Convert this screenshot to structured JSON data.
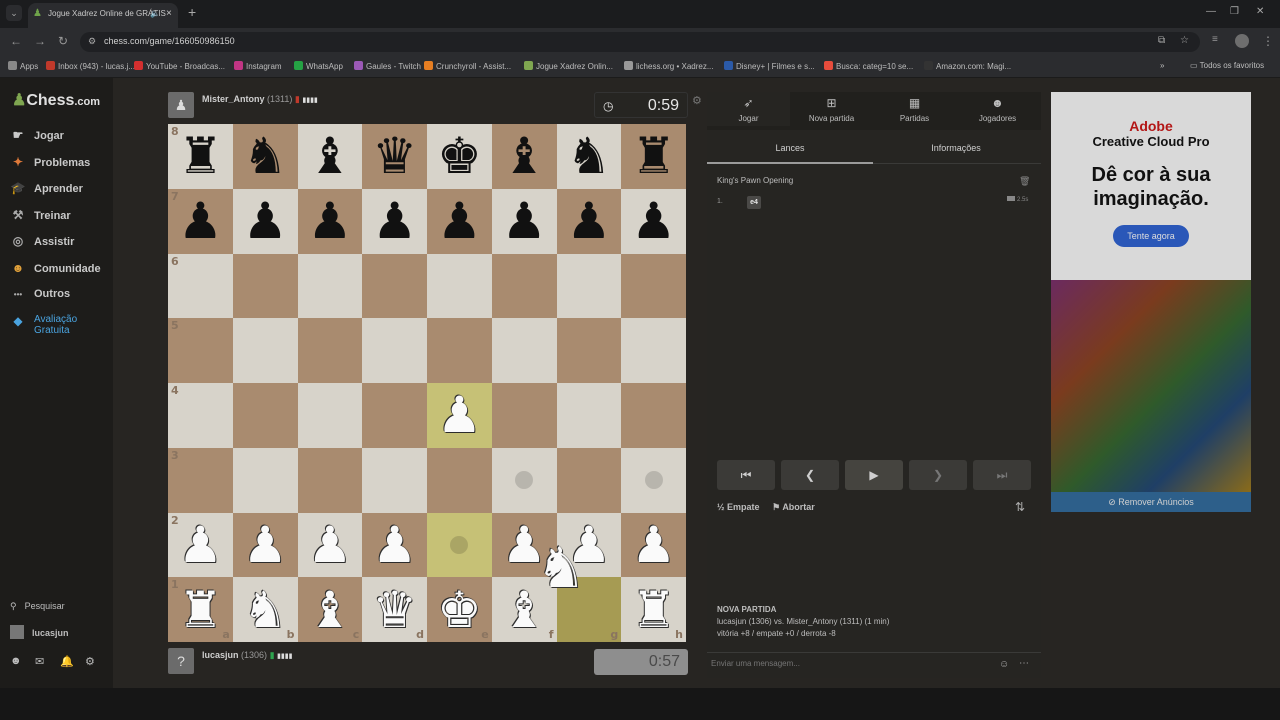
{
  "browser": {
    "tab_title": "Jogue Xadrez Online de GRÁTIS",
    "url": "chess.com/game/166050986150",
    "bookmarks": [
      {
        "label": "Apps",
        "color": "#888888"
      },
      {
        "label": "Inbox (943) - lucas.j...",
        "color": "#c0392b"
      },
      {
        "label": "YouTube - Broadcas...",
        "color": "#d32f2f"
      },
      {
        "label": "Instagram",
        "color": "#c13584"
      },
      {
        "label": "WhatsApp",
        "color": "#25a244"
      },
      {
        "label": "Gaules - Twitch",
        "color": "#9b59b6"
      },
      {
        "label": "Crunchyroll - Assist...",
        "color": "#e67e22"
      },
      {
        "label": "Jogue Xadrez Onlin...",
        "color": "#7fa650"
      },
      {
        "label": "lichess.org • Xadrez...",
        "color": "#999999"
      },
      {
        "label": "Disney+ | Filmes e s...",
        "color": "#2b5aa8"
      },
      {
        "label": "Busca: categ=10 se...",
        "color": "#e74c3c"
      },
      {
        "label": "Amazon.com: Magi...",
        "color": "#333333"
      }
    ],
    "favorites_label": "Todos os favoritos"
  },
  "sidebar": {
    "logo_a": "Chess",
    "logo_b": ".com",
    "items": [
      {
        "label": "Jogar",
        "icon": "play-hand-icon"
      },
      {
        "label": "Problemas",
        "icon": "puzzle-icon"
      },
      {
        "label": "Aprender",
        "icon": "graduation-cap-icon"
      },
      {
        "label": "Treinar",
        "icon": "train-icon"
      },
      {
        "label": "Assistir",
        "icon": "binoculars-icon"
      },
      {
        "label": "Comunidade",
        "icon": "community-icon"
      },
      {
        "label": "Outros",
        "icon": "more-icon"
      },
      {
        "label": "Avaliação Gratuita",
        "icon": "diamond-icon"
      }
    ],
    "search_label": "Pesquisar",
    "user_label": "lucasjun"
  },
  "top_player": {
    "name": "Mister_Antony",
    "rating": "(1311)",
    "clock": "0:59"
  },
  "bottom_player": {
    "name": "lucasjun",
    "rating": "(1306)",
    "clock": "0:57"
  },
  "board": {
    "rows": [
      [
        "br",
        "bn",
        "bb",
        "bq",
        "bk",
        "bb",
        "bn",
        "br"
      ],
      [
        "bp",
        "bp",
        "bp",
        "bp",
        "bp",
        "bp",
        "bp",
        "bp"
      ],
      [
        "",
        "",
        "",
        "",
        "",
        "",
        "",
        ""
      ],
      [
        "",
        "",
        "",
        "",
        "",
        "",
        "",
        ""
      ],
      [
        "",
        "",
        "",
        "",
        "wp",
        "",
        "",
        ""
      ],
      [
        "",
        "",
        "",
        "",
        "",
        "dot",
        "",
        "dot"
      ],
      [
        "wp",
        "wp",
        "wp",
        "wp",
        "dot",
        "wp",
        "wp",
        "wp"
      ],
      [
        "wr",
        "wn",
        "wb",
        "wq",
        "wk",
        "wb",
        "",
        "wr"
      ]
    ],
    "highlight": [
      "e4",
      "e2",
      "g1"
    ],
    "ranks": [
      "8",
      "7",
      "6",
      "5",
      "4",
      "3",
      "2",
      "1"
    ],
    "files": [
      "a",
      "b",
      "c",
      "d",
      "e",
      "f",
      "g",
      "h"
    ]
  },
  "panel": {
    "tabs": [
      {
        "label": "Jogar",
        "icon": "play-icon"
      },
      {
        "label": "Nova partida",
        "icon": "plus-icon"
      },
      {
        "label": "Partidas",
        "icon": "board-icon"
      },
      {
        "label": "Jogadores",
        "icon": "players-icon"
      }
    ],
    "subtabs": [
      "Lances",
      "Informações"
    ],
    "opening": "King's Pawn Opening",
    "move_number": "1.",
    "move_white": "e4",
    "move_time": "2.5s",
    "draw_label": "Empate",
    "abort_label": "Abortar",
    "new_game_title": "NOVA PARTIDA",
    "game_line1": "lucasjun (1306) vs. Mister_Antony (1311) (1 min)",
    "game_line2": "vitória +8 / empate +0 / derrota -8",
    "chat_placeholder": "Enviar uma mensagem..."
  },
  "ad": {
    "brand": "Adobe",
    "product": "Creative Cloud Pro",
    "headline": "Dê cor à sua imaginação.",
    "cta": "Tente agora",
    "remove": "Remover Anúncios"
  }
}
